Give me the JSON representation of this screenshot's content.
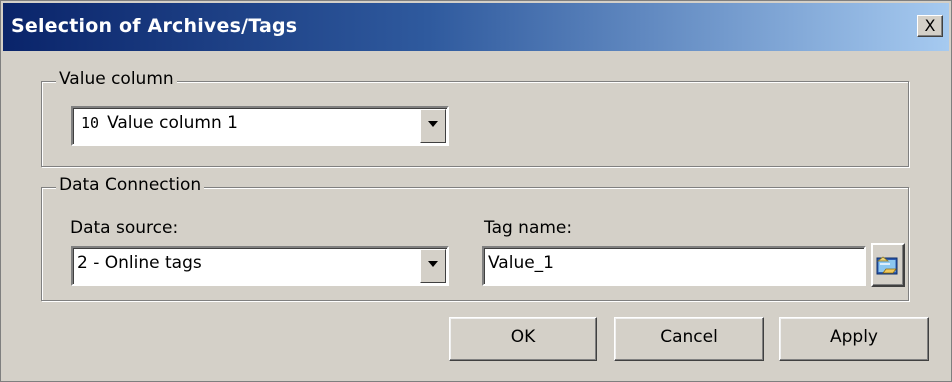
{
  "window": {
    "title": "Selection of Archives/Tags",
    "close_glyph": "X"
  },
  "value_column_group": {
    "legend": "Value column",
    "combo": {
      "badge": "10",
      "selected": "Value column 1"
    }
  },
  "data_connection_group": {
    "legend": "Data Connection",
    "data_source": {
      "label": "Data source:",
      "selected": "2 - Online tags"
    },
    "tag_name": {
      "label": "Tag name:",
      "value": "Value_1"
    }
  },
  "buttons": {
    "ok": "OK",
    "cancel": "Cancel",
    "apply": "Apply"
  }
}
